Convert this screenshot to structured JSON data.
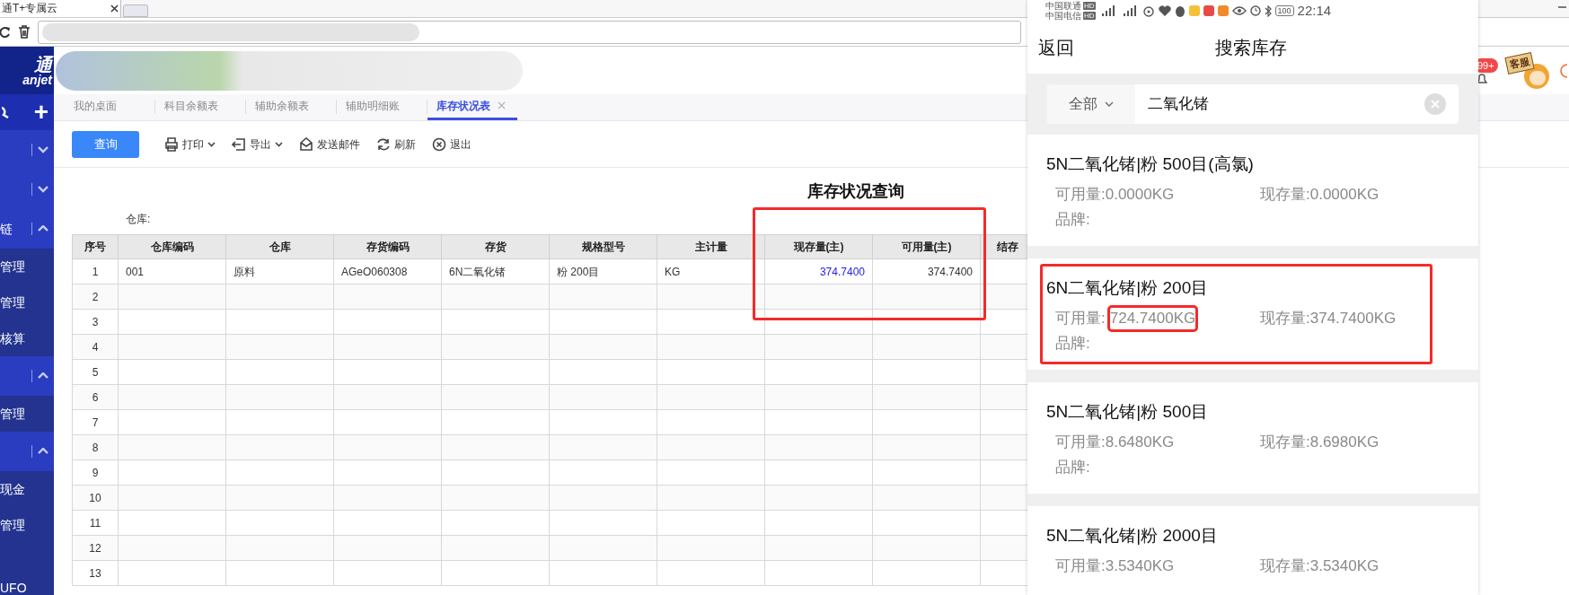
{
  "browser": {
    "tab_title": "通T+专属云"
  },
  "app": {
    "logo_cn": "通",
    "logo_en": "anjet",
    "badge": "99+",
    "mascot_label": "客服"
  },
  "sidebar": {
    "add_label": "+",
    "items": [
      {
        "kind": "group",
        "expanded": false
      },
      {
        "kind": "group",
        "expanded": false
      },
      {
        "kind": "group",
        "label": "链",
        "expanded": true
      },
      {
        "kind": "item",
        "label": "管理"
      },
      {
        "kind": "item",
        "label": "管理"
      },
      {
        "kind": "item",
        "label": "核算"
      },
      {
        "kind": "group",
        "expanded": true
      },
      {
        "kind": "item",
        "label": "管理"
      },
      {
        "kind": "group",
        "expanded": true
      },
      {
        "kind": "item",
        "label": "现金"
      },
      {
        "kind": "item",
        "label": "管理"
      },
      {
        "kind": "footer",
        "label": "UFO"
      }
    ]
  },
  "tabs": [
    {
      "label": "我的桌面",
      "selected": false,
      "closable": false
    },
    {
      "label": "科目余额表",
      "selected": false,
      "closable": false
    },
    {
      "label": "辅助余额表",
      "selected": false,
      "closable": false
    },
    {
      "label": "辅助明细账",
      "selected": false,
      "closable": false
    },
    {
      "label": "库存状况表",
      "selected": true,
      "closable": true
    }
  ],
  "toolbar": [
    {
      "kind": "primary",
      "label": "查询",
      "dropdown": false
    },
    {
      "kind": "print",
      "label": "打印",
      "dropdown": true
    },
    {
      "kind": "export",
      "label": "导出",
      "dropdown": true
    },
    {
      "kind": "mail",
      "label": "发送邮件",
      "dropdown": false
    },
    {
      "kind": "refresh",
      "label": "刷新",
      "dropdown": false
    },
    {
      "kind": "exit",
      "label": "退出",
      "dropdown": false
    }
  ],
  "report": {
    "title": "库存状况查询",
    "warehouse_label": "仓库:"
  },
  "table": {
    "highlight_box": true,
    "columns": [
      {
        "label": "序号",
        "kind": "index"
      },
      {
        "label": "仓库编码",
        "kind": "text"
      },
      {
        "label": "仓库",
        "kind": "text"
      },
      {
        "label": "存货编码",
        "kind": "text"
      },
      {
        "label": "存货",
        "kind": "text"
      },
      {
        "label": "规格型号",
        "kind": "text"
      },
      {
        "label": "主计量",
        "kind": "text"
      },
      {
        "label": "现存量(主)",
        "kind": "link"
      },
      {
        "label": "可用量(主)",
        "kind": "number"
      },
      {
        "label": "结存",
        "kind": "cut"
      }
    ],
    "rows": [
      {
        "no": "1",
        "cells": [
          "001",
          "原料",
          "AGeO060308",
          "6N二氧化锗",
          "粉 200目",
          "KG",
          "374.7400",
          "374.7400"
        ]
      },
      {
        "no": "2"
      },
      {
        "no": "3"
      },
      {
        "no": "4"
      },
      {
        "no": "5"
      },
      {
        "no": "6"
      },
      {
        "no": "7"
      },
      {
        "no": "8"
      },
      {
        "no": "9"
      },
      {
        "no": "10"
      },
      {
        "no": "11"
      },
      {
        "no": "12"
      },
      {
        "no": "13"
      }
    ]
  },
  "phone": {
    "status_bar": {
      "carriers": [
        {
          "name": "中国联通",
          "badge": "HD"
        },
        {
          "name": "中国电信",
          "badge": "HD"
        }
      ],
      "battery": "100",
      "time": "22:14"
    },
    "header": {
      "back": "返回",
      "title": "搜索库存"
    },
    "search": {
      "scope": "全部",
      "value": "二氧化锗"
    },
    "results": [
      {
        "name": "5N二氧化锗|粉 500目(高氯)",
        "available_label": "可用量:",
        "available": "0.0000KG",
        "on_hand_label": "现存量:",
        "on_hand": "0.0000KG",
        "brand_label": "品牌:",
        "highlighted": false,
        "value_highlighted": false
      },
      {
        "name": "6N二氧化锗|粉 200目",
        "available_label": "可用量:",
        "available": "724.7400KG",
        "on_hand_label": "现存量:",
        "on_hand": "374.7400KG",
        "brand_label": "品牌:",
        "highlighted": true,
        "value_highlighted": true
      },
      {
        "name": "5N二氧化锗|粉 500目",
        "available_label": "可用量:",
        "available": "8.6480KG",
        "on_hand_label": "现存量:",
        "on_hand": "8.6980KG",
        "brand_label": "品牌:",
        "highlighted": false,
        "value_highlighted": false
      },
      {
        "name": "5N二氧化锗|粉 2000目",
        "available_label": "可用量:",
        "available": "3.5340KG",
        "on_hand_label": "现存量:",
        "on_hand": "3.5340KG",
        "highlighted": false,
        "value_highlighted": false
      }
    ]
  }
}
